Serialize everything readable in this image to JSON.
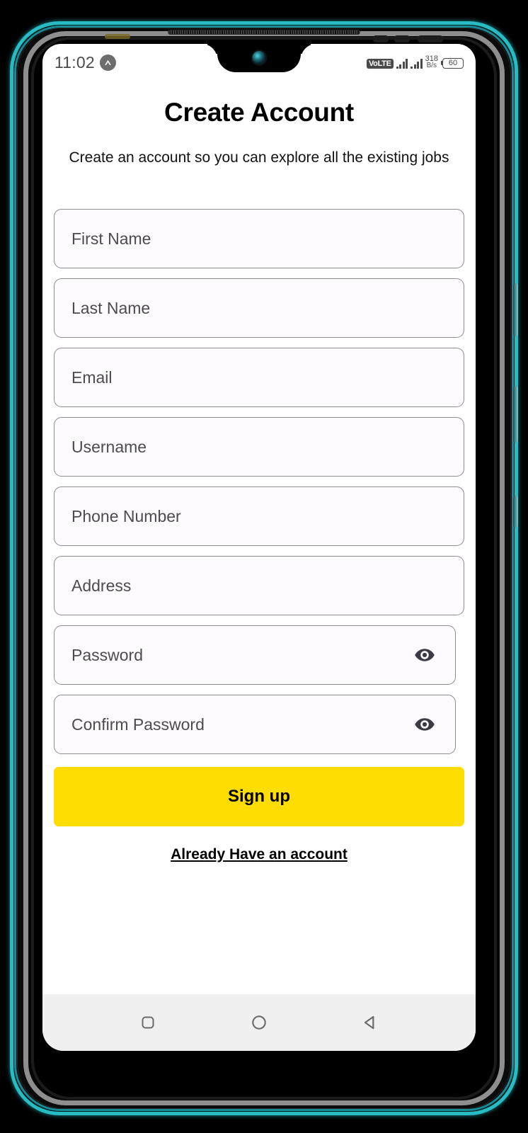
{
  "status_bar": {
    "time": "11:02",
    "vpn_icon": "caret-up-circle-icon",
    "volte_label": "VoLTE",
    "signal_1_icon": "signal-bars-icon",
    "signal_2_icon": "signal-bars-icon",
    "net_speed_value": "318",
    "net_speed_unit": "B/s",
    "battery_level": "60"
  },
  "screen": {
    "title": "Create Account",
    "subtitle": "Create an account so you can explore all the existing jobs"
  },
  "form": {
    "fields": [
      {
        "name": "first-name",
        "placeholder": "First Name",
        "has_toggle": false
      },
      {
        "name": "last-name",
        "placeholder": "Last Name",
        "has_toggle": false
      },
      {
        "name": "email",
        "placeholder": "Email",
        "has_toggle": false
      },
      {
        "name": "username",
        "placeholder": "Username",
        "has_toggle": false
      },
      {
        "name": "phone-number",
        "placeholder": "Phone Number",
        "has_toggle": false
      },
      {
        "name": "address",
        "placeholder": "Address",
        "has_toggle": false
      },
      {
        "name": "password",
        "placeholder": "Password",
        "has_toggle": true
      },
      {
        "name": "confirm-password",
        "placeholder": "Confirm Password",
        "has_toggle": true
      }
    ],
    "submit_label": "Sign up",
    "login_link_label": "Already Have an account",
    "toggle_icon": "eye-icon"
  },
  "nav_bar": {
    "recents_icon": "square-icon",
    "home_icon": "circle-icon",
    "back_icon": "triangle-left-icon"
  },
  "colors": {
    "accent_yellow": "#ffdd00",
    "phone_edge_teal": "#27bcc4",
    "field_border": "#8e8b93",
    "field_fill": "#fdfbfe",
    "placeholder_text": "#4d4a52",
    "nav_bar_bg": "#f0f0f0"
  }
}
